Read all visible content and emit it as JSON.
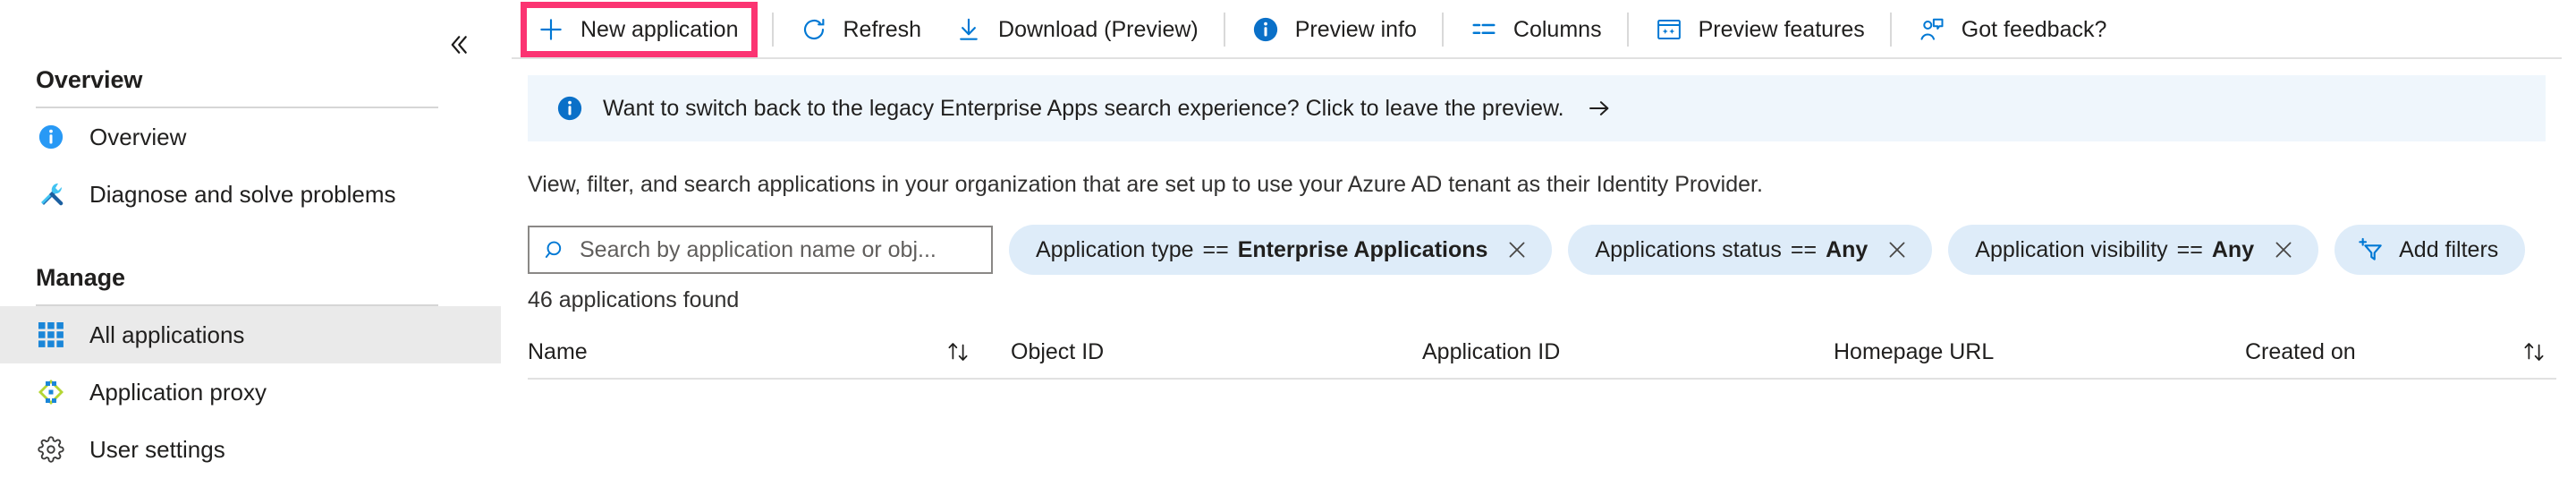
{
  "sidebar": {
    "collapse_icon": "double-chevron-left-icon",
    "sections": [
      {
        "title": "Overview",
        "items": [
          {
            "label": "Overview",
            "icon": "info-circle-icon",
            "selected": false
          },
          {
            "label": "Diagnose and solve problems",
            "icon": "wrench-screwdriver-icon",
            "selected": false
          }
        ]
      },
      {
        "title": "Manage",
        "items": [
          {
            "label": "All applications",
            "icon": "grid-apps-icon",
            "selected": true
          },
          {
            "label": "Application proxy",
            "icon": "proxy-diamond-icon",
            "selected": false
          },
          {
            "label": "User settings",
            "icon": "gear-icon",
            "selected": false
          }
        ]
      }
    ]
  },
  "toolbar": {
    "items": [
      {
        "label": "New application",
        "icon": "plus-icon",
        "highlighted": true
      },
      {
        "label": "Refresh",
        "icon": "refresh-icon",
        "highlighted": false
      },
      {
        "label": "Download (Preview)",
        "icon": "download-icon",
        "highlighted": false
      },
      {
        "label": "Preview info",
        "icon": "info-circle-icon",
        "highlighted": false
      },
      {
        "label": "Columns",
        "icon": "columns-icon",
        "highlighted": false
      },
      {
        "label": "Preview features",
        "icon": "preview-features-icon",
        "highlighted": false
      },
      {
        "label": "Got feedback?",
        "icon": "feedback-person-icon",
        "highlighted": false
      }
    ],
    "highlight_color": "#fb3472",
    "accent_color": "#0078d4"
  },
  "banner": {
    "icon": "info-circle-icon",
    "text": "Want to switch back to the legacy Enterprise Apps search experience? Click to leave the preview.",
    "arrow": "arrow-right-icon",
    "background": "#eff6fc"
  },
  "description": "View, filter, and search applications in your organization that are set up to use your Azure AD tenant as their Identity Provider.",
  "search": {
    "icon": "search-icon",
    "placeholder": "Search by application name or obj...",
    "value": ""
  },
  "filters": {
    "pills": [
      {
        "field": "Application type",
        "operator": "==",
        "value": "Enterprise Applications",
        "remove_icon": "close-icon"
      },
      {
        "field": "Applications status",
        "operator": "==",
        "value": "Any",
        "remove_icon": "close-icon"
      },
      {
        "field": "Application visibility",
        "operator": "==",
        "value": "Any",
        "remove_icon": "close-icon"
      }
    ],
    "add_button": {
      "label": "Add filters",
      "icon": "add-filter-funnel-icon"
    }
  },
  "results": {
    "count_text": "46 applications found"
  },
  "table": {
    "columns": [
      {
        "label": "Name",
        "sortable": true,
        "sort_icon": "sort-updown-icon"
      },
      {
        "label": "Object ID",
        "sortable": false
      },
      {
        "label": "Application ID",
        "sortable": false
      },
      {
        "label": "Homepage URL",
        "sortable": false
      },
      {
        "label": "Created on",
        "sortable": true,
        "sort_icon": "sort-updown-icon"
      }
    ],
    "rows": []
  }
}
